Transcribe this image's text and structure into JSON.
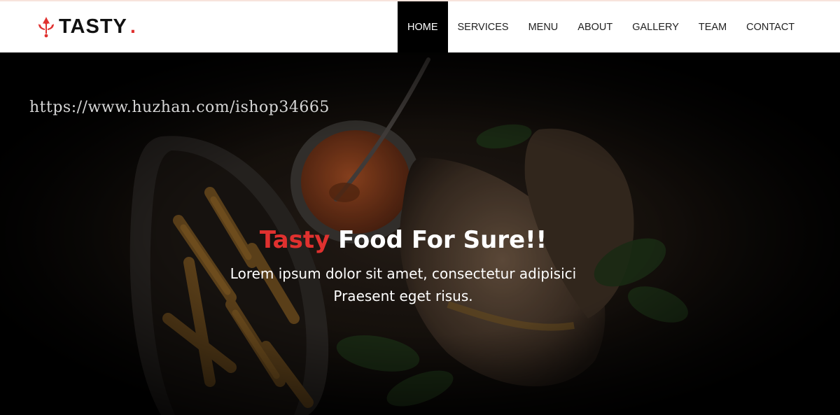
{
  "brand": {
    "name": "TASTY",
    "dot": ".",
    "accent_color": "#e0312f"
  },
  "nav": {
    "items": [
      {
        "label": "HOME",
        "active": true
      },
      {
        "label": "SERVICES"
      },
      {
        "label": "MENU"
      },
      {
        "label": "ABOUT"
      },
      {
        "label": "GALLERY"
      },
      {
        "label": "TEAM"
      },
      {
        "label": "CONTACT"
      }
    ]
  },
  "watermark": "https://www.huzhan.com/ishop34665",
  "hero": {
    "title_accent": "Tasty",
    "title_rest": "Food For Sure!!",
    "subtitle_line1": "Lorem ipsum dolor sit amet, consectetur adipisici",
    "subtitle_line2": "Praesent eget risus.",
    "image": "dark food photo: fries, dipping sauce with spoon, grilled sandwich, greens"
  }
}
